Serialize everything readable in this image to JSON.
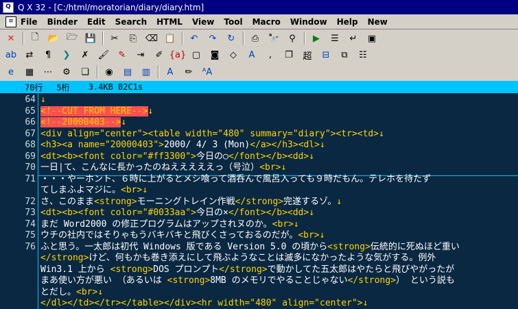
{
  "window": {
    "title": "Q X 32 - [C:/html/moratorian/diary/diary.htm]"
  },
  "menu": [
    "File",
    "Binder",
    "Edit",
    "Search",
    "HTML",
    "View",
    "Tool",
    "Macro",
    "Window",
    "Help",
    "New"
  ],
  "status": {
    "line": "70行",
    "column": "5桁",
    "size": "3.4KB 82C1s"
  },
  "lines": [
    {
      "n": "64",
      "segs": [
        {
          "t": "↓",
          "c": "nl"
        }
      ]
    },
    {
      "n": "65",
      "segs": [
        {
          "t": "<!--CUT FROM HERE-->",
          "c": "cut"
        },
        {
          "t": "↓",
          "c": "nl"
        }
      ]
    },
    {
      "n": "66",
      "segs": [
        {
          "t": "<!--20000403-->",
          "c": "cut"
        },
        {
          "t": "↓",
          "c": "nl"
        }
      ]
    },
    {
      "n": "67",
      "segs": [
        {
          "t": "<div align=\"center\"><table width=\"480\" summary=\"diary\"><tr><td>↓",
          "c": "tag"
        }
      ]
    },
    {
      "n": "68",
      "segs": [
        {
          "t": "<h3><a name=\"20000403\">",
          "c": "tag"
        },
        {
          "t": "2000/ 4/ 3 (Mon)",
          "c": ""
        },
        {
          "t": "</a></h3><dl>↓",
          "c": "tag"
        }
      ]
    },
    {
      "n": "69",
      "segs": [
        {
          "t": "<dt><b><font color=\"#ff3300\">",
          "c": "tag"
        },
        {
          "t": "今日の○",
          "c": ""
        },
        {
          "t": "</font></b><dd>↓",
          "c": "tag"
        }
      ]
    },
    {
      "n": "70",
      "segs": [
        {
          "t": "一日|て、こんなに長かったのねえええええっ（号泣）",
          "c": ""
        },
        {
          "t": "<br>↓",
          "c": "tag"
        }
      ]
    },
    {
      "n": "71",
      "segs": [
        {
          "t": "・・・やーホント、６時に上がるとメシ喰って酒呑んで風呂入っても９時だもん。テレホを待たず",
          "c": ""
        }
      ]
    },
    {
      "n": "",
      "segs": [
        {
          "t": "てしまふよマジに。",
          "c": ""
        },
        {
          "t": "<br>↓",
          "c": "tag"
        }
      ]
    },
    {
      "n": "72",
      "segs": [
        {
          "t": "さ、このまま",
          "c": ""
        },
        {
          "t": "<strong>",
          "c": "tag"
        },
        {
          "t": "モーニングトレイン作戦",
          "c": ""
        },
        {
          "t": "</strong>",
          "c": "tag"
        },
        {
          "t": "完遂するゾ。",
          "c": ""
        },
        {
          "t": "↓",
          "c": "nl"
        }
      ]
    },
    {
      "n": "73",
      "segs": [
        {
          "t": "<dt><b><font color=\"#0033aa\">",
          "c": "tag"
        },
        {
          "t": "今日の×",
          "c": ""
        },
        {
          "t": "</font></b><dd>↓",
          "c": "tag"
        }
      ]
    },
    {
      "n": "74",
      "segs": [
        {
          "t": "まだ Word2000 の修正プログラムはアップされヌのか。",
          "c": ""
        },
        {
          "t": "<br>↓",
          "c": "tag"
        }
      ]
    },
    {
      "n": "75",
      "segs": [
        {
          "t": "ウチの社内ではそりゃもうバキバキと飛びくさっておるのだが。",
          "c": ""
        },
        {
          "t": "<br>↓",
          "c": "tag"
        }
      ]
    },
    {
      "n": "76",
      "segs": [
        {
          "t": "ふと思う。一太郎は初代 Windows 版である Version 5.0 の頃から",
          "c": ""
        },
        {
          "t": "<strong>",
          "c": "tag"
        },
        {
          "t": "伝統的に死ぬほど重い",
          "c": ""
        }
      ]
    },
    {
      "n": "",
      "segs": [
        {
          "t": "</strong>",
          "c": "tag"
        },
        {
          "t": "けど、何もかも巻き添えにして飛ぶようなことは滅多になかったような気がする。例外",
          "c": ""
        }
      ]
    },
    {
      "n": "",
      "segs": [
        {
          "t": "Win3.1 上から ",
          "c": ""
        },
        {
          "t": "<strong>",
          "c": "tag"
        },
        {
          "t": "DOS プロンプト",
          "c": ""
        },
        {
          "t": "</strong>",
          "c": "tag"
        },
        {
          "t": "で動かしてた五太郎はやたらと飛びやがったが",
          "c": ""
        }
      ]
    },
    {
      "n": "",
      "segs": [
        {
          "t": "まあ使い方が悪い （あるいは ",
          "c": ""
        },
        {
          "t": "<strong>",
          "c": "tag"
        },
        {
          "t": "8MB のメモリでやることじゃない",
          "c": ""
        },
        {
          "t": "</strong>",
          "c": "tag"
        },
        {
          "t": "） という説も",
          "c": ""
        }
      ]
    },
    {
      "n": "",
      "segs": [
        {
          "t": "とだし。",
          "c": ""
        },
        {
          "t": "<br>↓",
          "c": "tag"
        }
      ]
    },
    {
      "n": "",
      "segs": [
        {
          "t": "</dl></td></tr></table></div><hr width=\"480\" align=\"center\">↓",
          "c": "tag"
        }
      ]
    }
  ],
  "toolbar1": [
    {
      "name": "close-doc-icon",
      "g": "✕",
      "color": "#e02020"
    },
    {
      "name": "new-doc-icon",
      "g": "🗋"
    },
    {
      "name": "open-folder-icon",
      "g": "📂"
    },
    {
      "name": "open-file-icon",
      "g": "🗁"
    },
    {
      "name": "save-icon",
      "g": "💾"
    },
    {
      "name": "cut-icon",
      "g": "✂"
    },
    {
      "name": "copy-icon",
      "g": "⎘"
    },
    {
      "name": "eraser-icon",
      "g": "⌫"
    },
    {
      "name": "paste-icon",
      "g": "📋"
    },
    {
      "name": "undo-icon",
      "g": "↶",
      "color": "#0040c0"
    },
    {
      "name": "redo-icon",
      "g": "↷",
      "color": "#0040c0"
    },
    {
      "name": "repeat-icon",
      "g": "↻",
      "color": "#0040c0"
    },
    {
      "name": "print-icon",
      "g": "⎙"
    },
    {
      "name": "find-icon",
      "g": "🔭"
    },
    {
      "name": "find-next-icon",
      "g": "⚲"
    },
    {
      "name": "macro-record-icon",
      "g": "▶",
      "color": "#008000"
    },
    {
      "name": "macro-list-icon",
      "g": "☰"
    },
    {
      "name": "jump-icon",
      "g": "↵"
    },
    {
      "name": "window-icon",
      "g": "▣"
    }
  ],
  "toolbar2": [
    {
      "name": "text-abc-icon",
      "g": "ab",
      "color": "#0040c0"
    },
    {
      "name": "replace-icon",
      "g": "⇄"
    },
    {
      "name": "text-format-icon",
      "g": "¶"
    },
    {
      "name": "chevron-right-icon",
      "g": "❯",
      "color": "#008080"
    },
    {
      "name": "tools-icon",
      "g": "✗"
    },
    {
      "name": "paint-icon",
      "g": "🖌"
    },
    {
      "name": "brush-icon",
      "g": "✎",
      "color": "#c00000"
    },
    {
      "name": "indent-icon",
      "g": "⇥"
    },
    {
      "name": "pen-icon",
      "g": "✐"
    },
    {
      "name": "braces-a-icon",
      "g": "{a}",
      "color": "#c00000"
    },
    {
      "name": "cube-icon",
      "g": "▢"
    },
    {
      "name": "screen-icon",
      "g": "◙"
    },
    {
      "name": "tag-icon",
      "g": "◇"
    },
    {
      "name": "font-a-icon",
      "g": "A",
      "color": "#0040c0"
    },
    {
      "name": "comma-icon",
      "g": ","
    },
    {
      "name": "pages-icon",
      "g": "❐"
    },
    {
      "name": "kanji-icon",
      "g": "超"
    },
    {
      "name": "split-icon",
      "g": "⊟",
      "color": "#0040c0"
    },
    {
      "name": "window-cascade-icon",
      "g": "⧉"
    },
    {
      "name": "window-tile-icon",
      "g": "☷"
    }
  ],
  "toolbar3": [
    {
      "name": "browser-icon",
      "g": "e",
      "color": "#0040c0"
    },
    {
      "name": "grid-icon",
      "g": "▦"
    },
    {
      "name": "double-icon",
      "g": "⋯"
    },
    {
      "name": "gear-icon",
      "g": "⚙"
    },
    {
      "name": "layers-icon",
      "g": "❏"
    },
    {
      "name": "preview-icon",
      "g": "◉"
    },
    {
      "name": "ruler-icon",
      "g": "▤",
      "color": "#0040c0"
    },
    {
      "name": "view-icon",
      "g": "▥",
      "color": "#0040c0"
    },
    {
      "name": "font-bold-a-icon",
      "g": "A",
      "color": "#0040c0"
    },
    {
      "name": "highlight-icon",
      "g": "✏"
    },
    {
      "name": "font-size-icon",
      "g": "ᴬA",
      "color": "#0040c0"
    }
  ]
}
